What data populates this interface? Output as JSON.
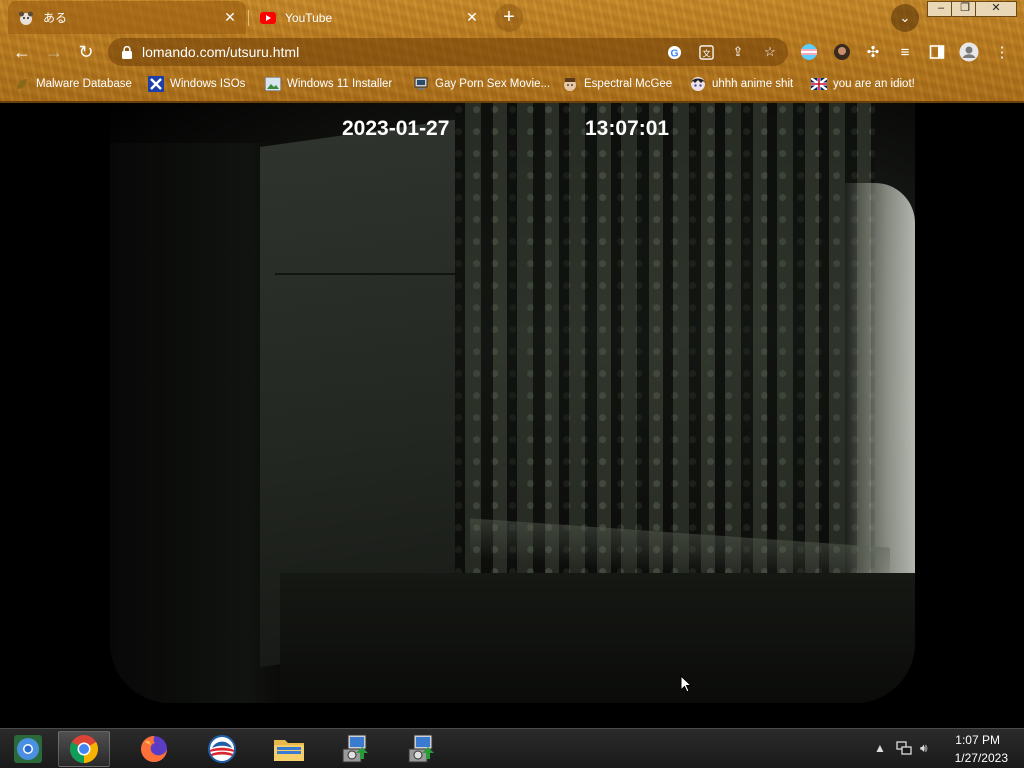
{
  "browser": {
    "tabs": [
      {
        "title": "ある",
        "active": true
      },
      {
        "title": "YouTube",
        "active": false
      }
    ],
    "new_tab_label": "+",
    "address": {
      "url": "lomando.com/utsuru.html"
    },
    "bookmarks": [
      {
        "label": "Malware Database",
        "icon": "leaf-icon"
      },
      {
        "label": "Windows ISOs",
        "icon": "x-logo-icon"
      },
      {
        "label": "Windows 11 Installer",
        "icon": "image-icon"
      },
      {
        "label": "Gay Porn Sex Movie...",
        "icon": "computer-icon"
      },
      {
        "label": "Espectral McGee",
        "icon": "face-icon"
      },
      {
        "label": "uhhh anime shit",
        "icon": "anime-icon"
      },
      {
        "label": "you are an idiot!",
        "icon": "flag-icon"
      }
    ],
    "theme_color": "#b97b1f"
  },
  "camera": {
    "date": "2023-01-27",
    "time": "13:07:01"
  },
  "taskbar": {
    "apps": [
      {
        "name": "chromium",
        "active": false
      },
      {
        "name": "chrome",
        "active": true
      },
      {
        "name": "firefox",
        "active": false
      },
      {
        "name": "obama-logo",
        "active": false
      },
      {
        "name": "file-explorer",
        "active": false
      },
      {
        "name": "installer-1",
        "active": false
      },
      {
        "name": "installer-2",
        "active": false
      }
    ],
    "clock": {
      "time": "1:07 PM",
      "date": "1/27/2023"
    }
  }
}
